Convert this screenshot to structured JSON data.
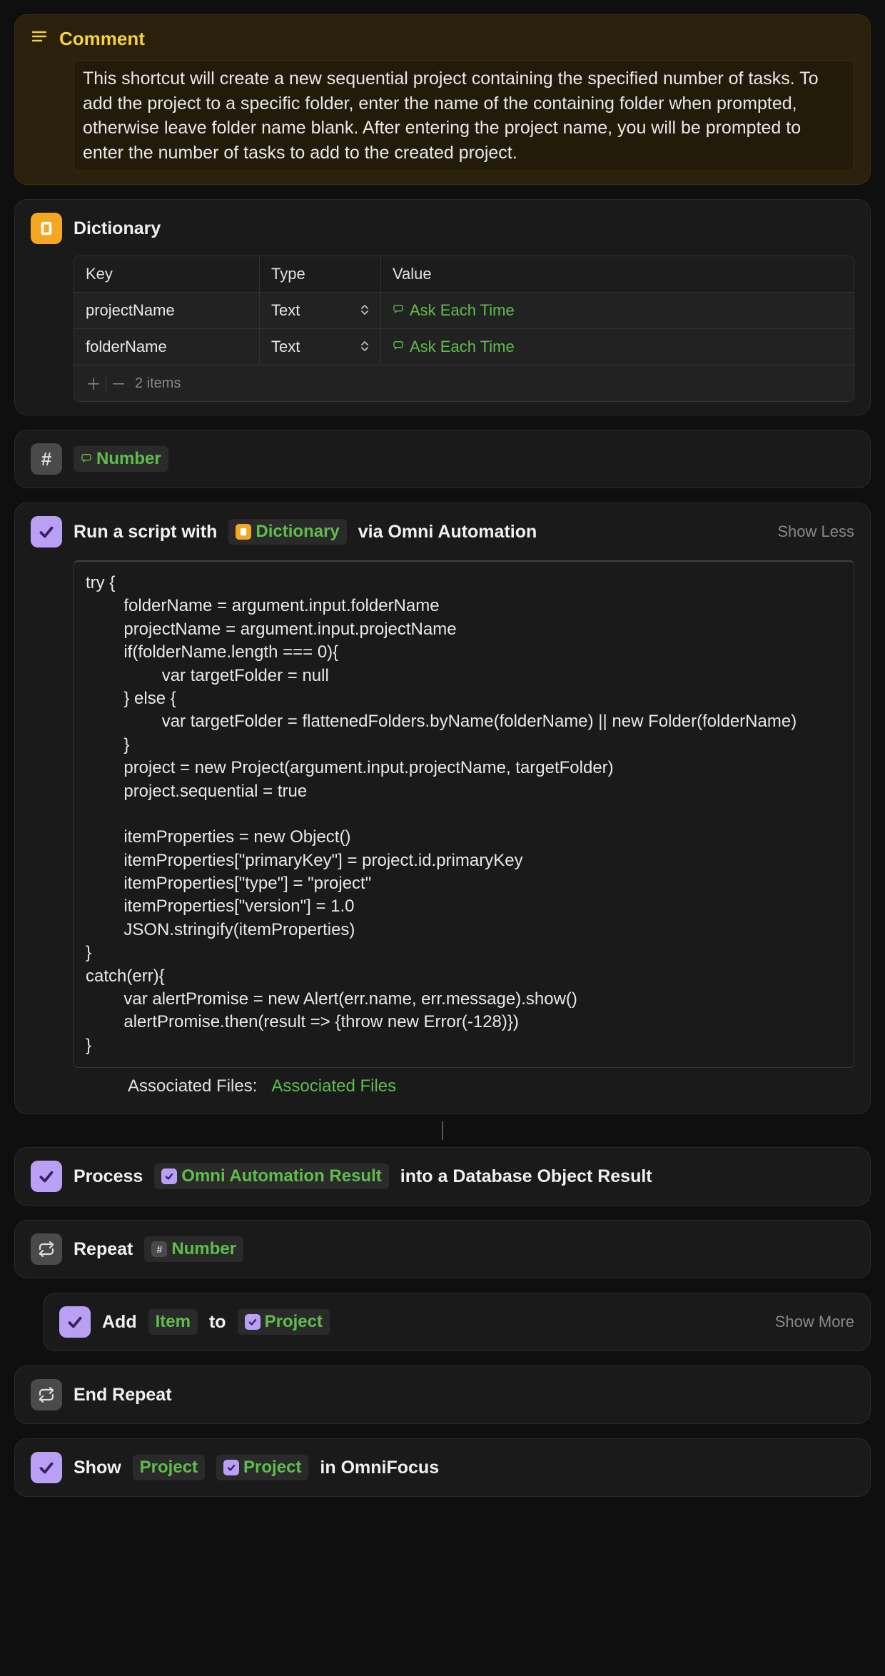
{
  "comment": {
    "title": "Comment",
    "body": "This shortcut will create a new sequential project containing the specified number of tasks. To add the project to a specific folder, enter the name of the containing folder when prompted, otherwise leave folder name blank. After entering the project name, you will be prompted to enter the number of tasks to add to the created project."
  },
  "dictionary": {
    "title": "Dictionary",
    "headers": {
      "key": "Key",
      "type": "Type",
      "value": "Value"
    },
    "rows": [
      {
        "key": "projectName",
        "type": "Text",
        "value": "Ask Each Time"
      },
      {
        "key": "folderName",
        "type": "Text",
        "value": "Ask Each Time"
      }
    ],
    "footer_count": "2 items"
  },
  "number_action": {
    "label": "Number"
  },
  "script": {
    "prefix": "Run a script with",
    "token": "Dictionary",
    "suffix": "via Omni Automation",
    "toggle": "Show Less",
    "code": "try {\n        folderName = argument.input.folderName\n        projectName = argument.input.projectName\n        if(folderName.length === 0){\n                var targetFolder = null\n        } else {\n                var targetFolder = flattenedFolders.byName(folderName) || new Folder(folderName)\n        }\n        project = new Project(argument.input.projectName, targetFolder)\n        project.sequential = true\n\n        itemProperties = new Object()\n        itemProperties[\"primaryKey\"] = project.id.primaryKey\n        itemProperties[\"type\"] = \"project\"\n        itemProperties[\"version\"] = 1.0\n        JSON.stringify(itemProperties)\n}\ncatch(err){\n        var alertPromise = new Alert(err.name, err.message).show()\n        alertPromise.then(result => {throw new Error(-128)})\n}",
    "assoc_label": "Associated Files:",
    "assoc_value": "Associated Files"
  },
  "process": {
    "prefix": "Process",
    "token": "Omni Automation Result",
    "suffix": "into a Database Object Result"
  },
  "repeat": {
    "label": "Repeat",
    "token": "Number"
  },
  "add": {
    "prefix": "Add",
    "item_token": "Item",
    "middle": "to",
    "project_token": "Project",
    "toggle": "Show More"
  },
  "end_repeat": {
    "label": "End Repeat"
  },
  "show": {
    "prefix": "Show",
    "project_text_token": "Project",
    "project_icon_token": "Project",
    "suffix": "in OmniFocus"
  }
}
